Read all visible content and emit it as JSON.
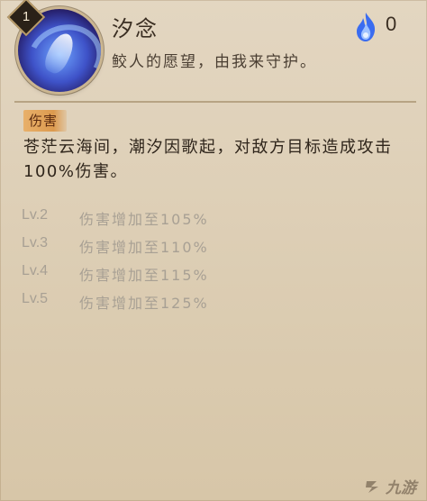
{
  "skill": {
    "level": "1",
    "name": "汐念",
    "quote": "鲛人的愿望，由我来守护。",
    "cost": "0",
    "cost_icon": "blue-fire-icon",
    "tag": "伤害",
    "description": "苍茫云海间，潮汐因歌起，对敌方目标造成攻击100%伤害。"
  },
  "levels": [
    {
      "label": "Lv.2",
      "effect": "伤害增加至105%"
    },
    {
      "label": "Lv.3",
      "effect": "伤害增加至110%"
    },
    {
      "label": "Lv.4",
      "effect": "伤害增加至115%"
    },
    {
      "label": "Lv.5",
      "effect": "伤害增加至125%"
    }
  ],
  "watermark": {
    "text": "九游",
    "icon": "jiuyou-logo-icon"
  },
  "colors": {
    "background": "#e3d6c1",
    "tag_bg": "#e8b06a",
    "muted_text": "#a8a094",
    "primary_text": "#2f251b",
    "fire": "#3a6cf0"
  }
}
